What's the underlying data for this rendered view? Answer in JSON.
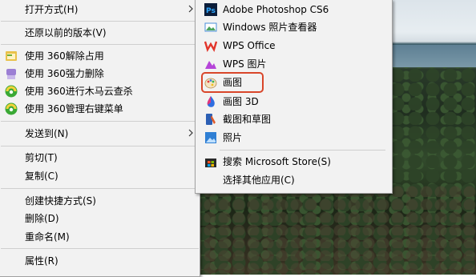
{
  "main_menu": {
    "open_with": "打开方式(H)",
    "restore_previous": "还原以前的版本(V)",
    "unlock_360": "使用 360解除占用",
    "force_delete_360": "使用 360强力删除",
    "trojan_scan_360": "使用 360进行木马云查杀",
    "manage_menu_360": "使用 360管理右键菜单",
    "send_to": "发送到(N)",
    "cut": "剪切(T)",
    "copy": "复制(C)",
    "create_shortcut": "创建快捷方式(S)",
    "delete": "删除(D)",
    "rename": "重命名(M)",
    "properties": "属性(R)"
  },
  "sub_menu": {
    "photoshop": "Adobe Photoshop CS6",
    "windows_viewer": "Windows 照片查看器",
    "wps_office": "WPS Office",
    "wps_image": "WPS 图片",
    "paint": "画图",
    "paint3d": "画图 3D",
    "snip_sketch": "截图和草图",
    "photos": "照片",
    "store_search": "搜索 Microsoft Store(S)",
    "choose_other": "选择其他应用(C)"
  },
  "colors": {
    "highlight_border": "#d9462a",
    "menu_background": "#f2f2f2"
  }
}
